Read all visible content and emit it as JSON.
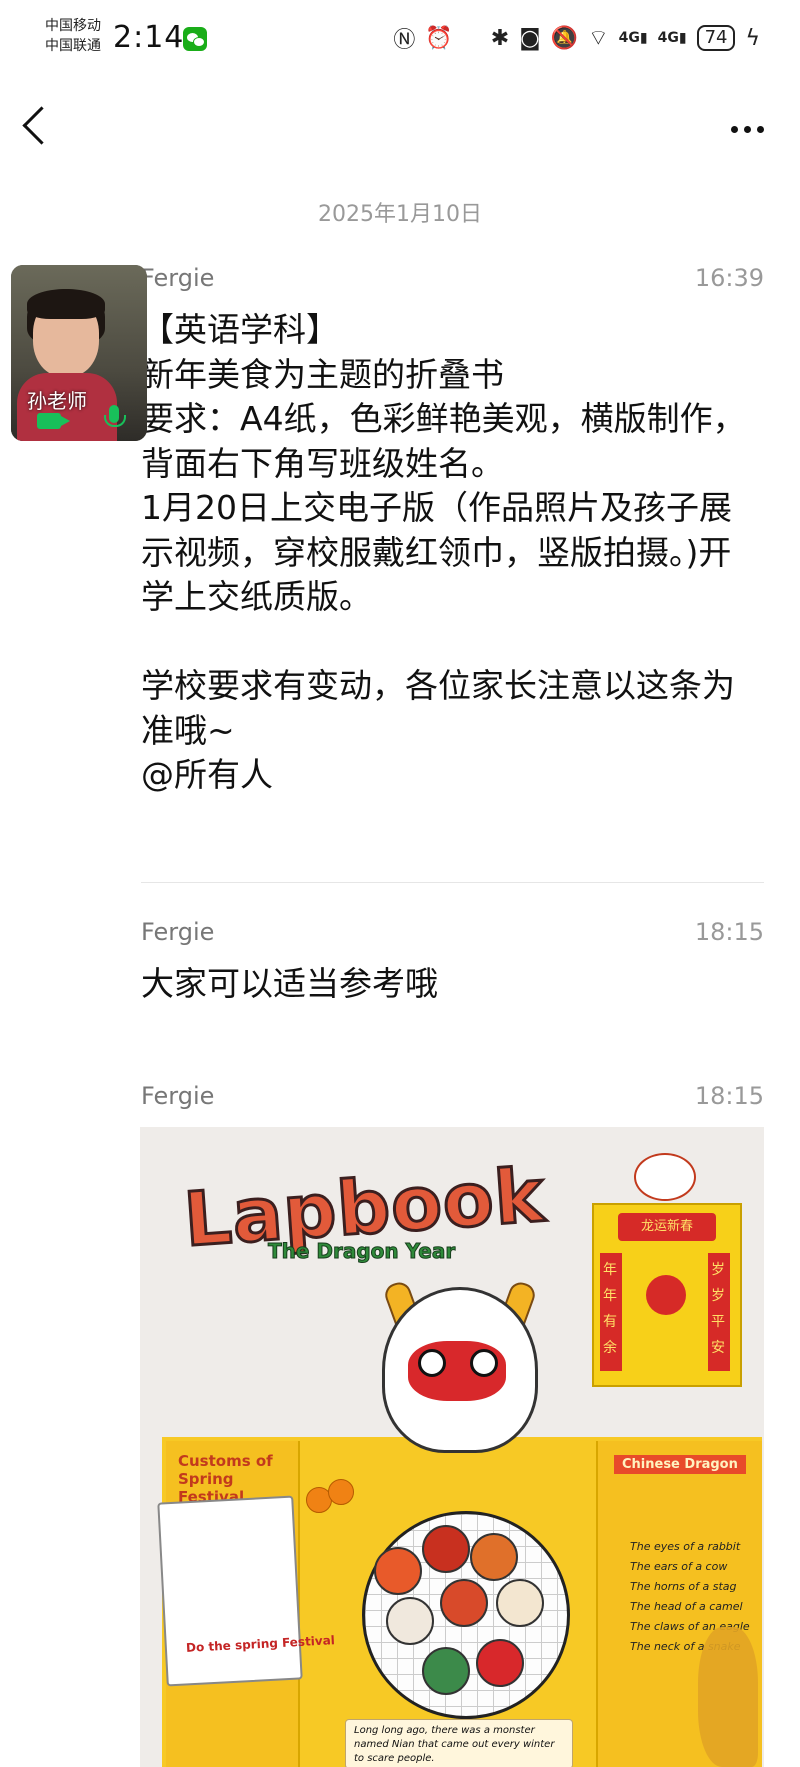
{
  "status_bar": {
    "carrier_1": "中国移动",
    "carrier_2": "中国联通",
    "time": "2:14",
    "network_1": "4G",
    "network_2": "4G",
    "battery": "74"
  },
  "chat": {
    "date_separator": "2025年1月10日",
    "floating_call": {
      "name": "孙老师"
    },
    "messages": [
      {
        "sender": "Fergie",
        "time": "16:39",
        "text": "【英语学科】\n新年美食为主题的折叠书\n要求：A4纸，色彩鲜艳美观，横版制作，背面右下角写班级姓名。\n1月20日上交电子版（作品照片及孩子展示视频，穿校服戴红领巾，竖版拍摄。)开学上交纸质版。\n\n学校要求有变动，各位家长注意以这条为准哦~\n@所有人"
      },
      {
        "sender": "Fergie",
        "time": "18:15",
        "text": "大家可以适当参考哦"
      },
      {
        "sender": "Fergie",
        "time": "18:15",
        "image": {
          "title": "Lapbook",
          "subtitle": "The Dragon Year",
          "left_panel_title": "Customs of Spring Festival",
          "card_caption": "Do the spring Festival",
          "right_panel_title": "Chinese Dragon",
          "banner_top": "龙运新春",
          "banner_left": "年年有余",
          "banner_right": "岁岁平安",
          "dragon_facts": [
            "The eyes of a rabbit",
            "The ears of a cow",
            "The horns of a stag",
            "The head of a camel",
            "The claws of an eagle",
            "The neck of a snake"
          ],
          "story": "Long long ago, there was a monster named Nian that came out every winter to scare people."
        }
      }
    ]
  }
}
